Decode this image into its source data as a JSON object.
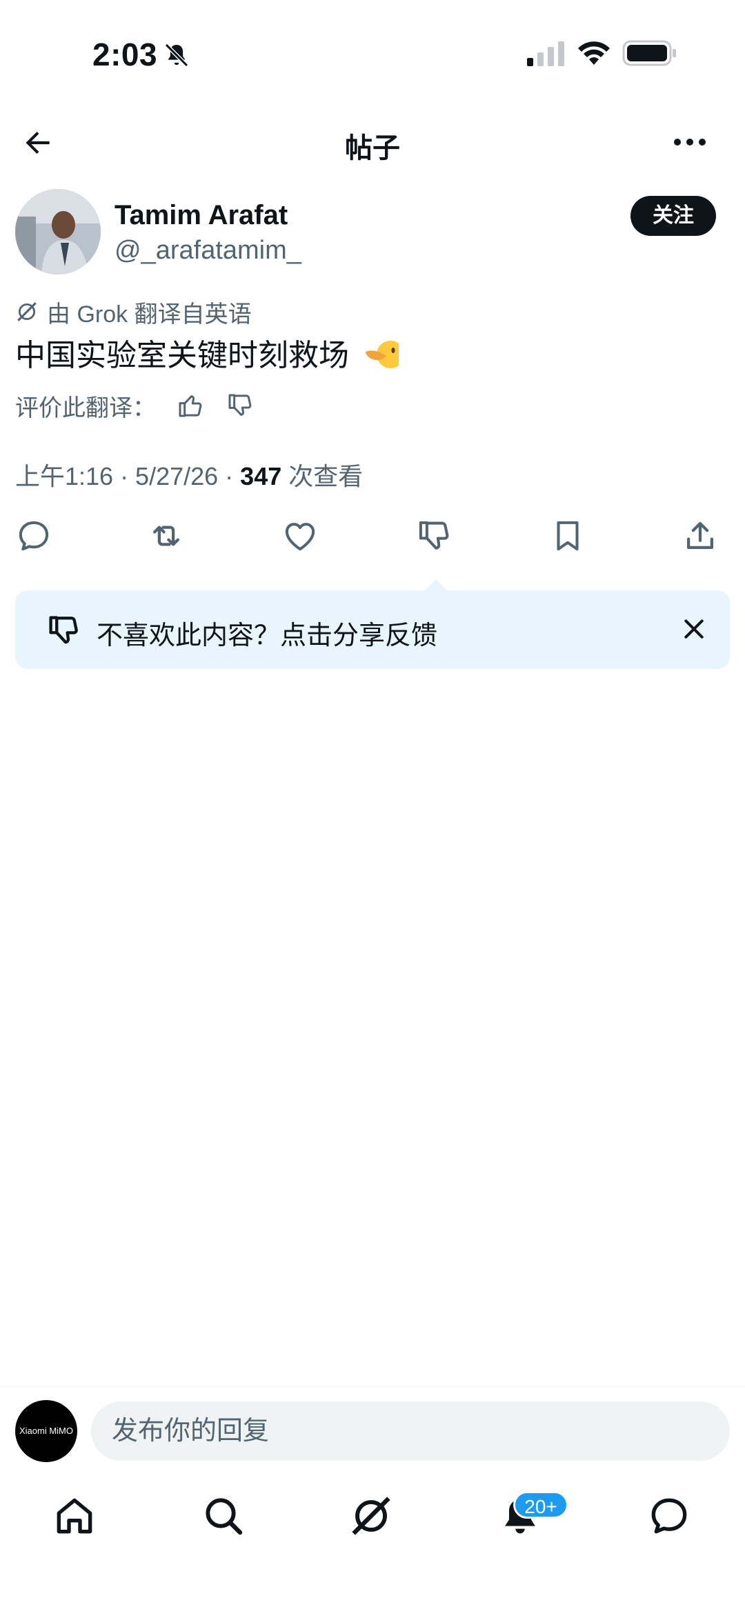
{
  "status_bar": {
    "time": "2:03"
  },
  "header": {
    "title": "帖子"
  },
  "post": {
    "author_name": "Tamim Arafat",
    "author_handle": "@_arafatamim_",
    "follow_label": "关注",
    "translation_label": "由 Grok 翻译自英语",
    "text": "中国实验室关键时刻救场",
    "rate_label": "评价此翻译：",
    "meta_prefix": "上午1:16 · 5/27/26 · ",
    "views": "347",
    "views_suffix": " 次查看"
  },
  "feedback": {
    "text": "不喜欢此内容？点击分享反馈"
  },
  "reply": {
    "placeholder": "发布你的回复",
    "my_avatar_text": "Xiaomi MiMO"
  },
  "nav": {
    "notification_badge": "20+"
  },
  "colors": {
    "accent": "#1d9bf0",
    "callout_bg": "#e8f5fd",
    "secondary_text": "#536471"
  }
}
